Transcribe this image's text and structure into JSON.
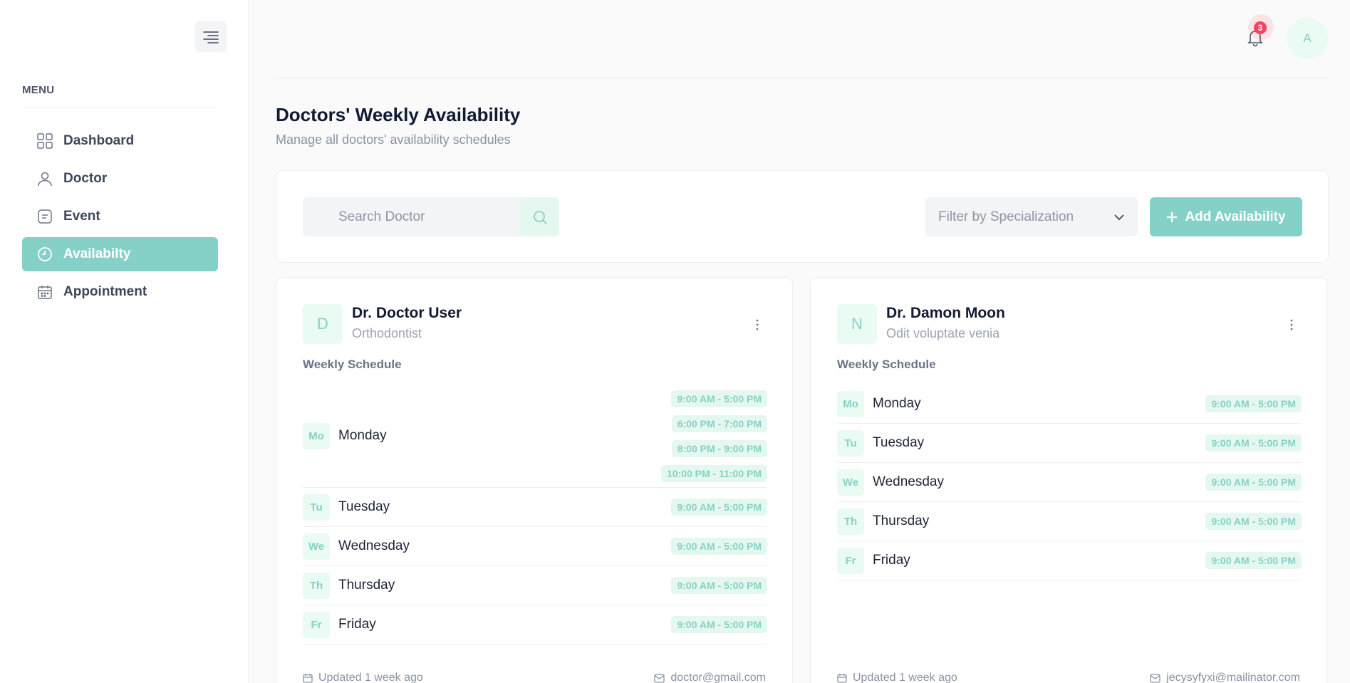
{
  "sidebar": {
    "menu_label": "MENU",
    "items": [
      {
        "label": "Dashboard",
        "icon": "grid-icon",
        "active": false
      },
      {
        "label": "Doctor",
        "icon": "user-icon",
        "active": false
      },
      {
        "label": "Event",
        "icon": "message-icon",
        "active": false
      },
      {
        "label": "Availabilty",
        "icon": "clock-icon",
        "active": true
      },
      {
        "label": "Appointment",
        "icon": "calendar-icon",
        "active": false
      }
    ]
  },
  "header": {
    "notification_count": "3",
    "avatar_initial": "A"
  },
  "page": {
    "title": "Doctors' Weekly Availability",
    "subtitle": "Manage all doctors' availability schedules"
  },
  "toolbar": {
    "search_placeholder": "Search Doctor",
    "filter_placeholder": "Filter by Specialization",
    "add_label": "Add Availability"
  },
  "doctors": [
    {
      "initial": "D",
      "name": "Dr. Doctor User",
      "specialization": "Orthodontist",
      "schedule_label": "Weekly Schedule",
      "schedule": [
        {
          "abbr": "Mo",
          "day": "Monday",
          "slots": [
            "9:00 AM - 5:00 PM",
            "6:00 PM - 7:00 PM",
            "8:00 PM - 9:00 PM",
            "10:00 PM - 11:00 PM"
          ]
        },
        {
          "abbr": "Tu",
          "day": "Tuesday",
          "slots": [
            "9:00 AM - 5:00 PM"
          ]
        },
        {
          "abbr": "We",
          "day": "Wednesday",
          "slots": [
            "9:00 AM - 5:00 PM"
          ]
        },
        {
          "abbr": "Th",
          "day": "Thursday",
          "slots": [
            "9:00 AM - 5:00 PM"
          ]
        },
        {
          "abbr": "Fr",
          "day": "Friday",
          "slots": [
            "9:00 AM - 5:00 PM"
          ]
        }
      ],
      "updated": "Updated 1 week ago",
      "email": "doctor@gmail.com"
    },
    {
      "initial": "N",
      "name": "Dr. Damon Moon",
      "specialization": "Odit voluptate venia",
      "schedule_label": "Weekly Schedule",
      "schedule": [
        {
          "abbr": "Mo",
          "day": "Monday",
          "slots": [
            "9:00 AM - 5:00 PM"
          ]
        },
        {
          "abbr": "Tu",
          "day": "Tuesday",
          "slots": [
            "9:00 AM - 5:00 PM"
          ]
        },
        {
          "abbr": "We",
          "day": "Wednesday",
          "slots": [
            "9:00 AM - 5:00 PM"
          ]
        },
        {
          "abbr": "Th",
          "day": "Thursday",
          "slots": [
            "9:00 AM - 5:00 PM"
          ]
        },
        {
          "abbr": "Fr",
          "day": "Friday",
          "slots": [
            "9:00 AM - 5:00 PM"
          ]
        }
      ],
      "updated": "Updated 1 week ago",
      "email": "jecysyfyxi@mailinator.com"
    }
  ],
  "colors": {
    "accent": "#86d1c7",
    "accent_soft": "#e4f8f0",
    "badge": "#ef4462"
  }
}
